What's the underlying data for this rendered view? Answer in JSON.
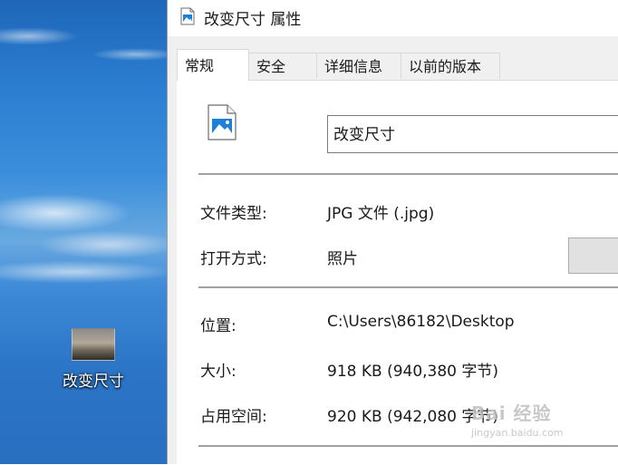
{
  "desktop": {
    "file_icon_label": "改变尺寸"
  },
  "window": {
    "title": "改变尺寸 属性",
    "tabs": [
      {
        "label": "常规",
        "active": true
      },
      {
        "label": "安全",
        "active": false
      },
      {
        "label": "详细信息",
        "active": false
      },
      {
        "label": "以前的版本",
        "active": false
      }
    ]
  },
  "general": {
    "file_name": "改变尺寸",
    "file_type_label": "文件类型:",
    "file_type_value": "JPG 文件 (.jpg)",
    "open_with_label": "打开方式:",
    "open_with_value": "照片",
    "location_label": "位置:",
    "location_value": "C:\\Users\\86182\\Desktop",
    "size_label": "大小:",
    "size_value": "918 KB (940,380 字节)",
    "size_on_disk_label": "占用空间:",
    "size_on_disk_value": "920 KB (942,080 字节)"
  },
  "watermark": {
    "logo": "Bai 经验",
    "url": "jingyan.baidu.com"
  },
  "icons": {
    "title": "image-file-icon",
    "big": "image-file-icon"
  },
  "colors": {
    "icon_blue": "#1e7fd8",
    "panel_bg": "#ffffff",
    "client_bg": "#f0f0f0"
  }
}
